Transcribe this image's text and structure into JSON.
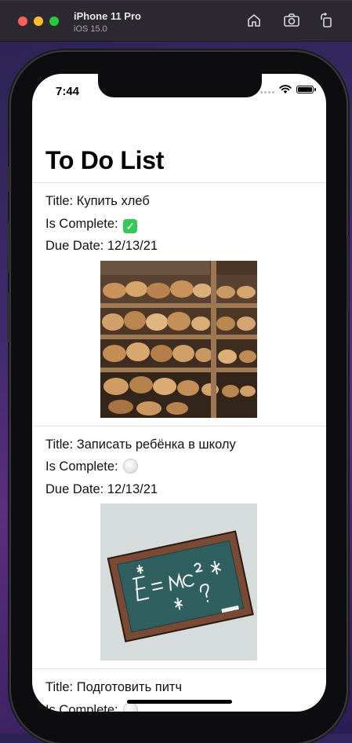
{
  "simulator": {
    "device": "iPhone 11 Pro",
    "os": "iOS 15.0",
    "icons": [
      "home-icon",
      "screenshot-icon",
      "rotate-icon"
    ]
  },
  "status_bar": {
    "time": "7:44"
  },
  "screen": {
    "title": "To Do List",
    "items": [
      {
        "title": "Title: Купить хлеб",
        "complete_label": "Is Complete:",
        "complete_state": "complete",
        "due": "Due Date: 12/13/21",
        "image": "bread-shelves-image"
      },
      {
        "title": "Title: Записать ребёнка в школу",
        "complete_label": "Is Complete:",
        "complete_state": "incomplete",
        "due": "Due Date: 12/13/21",
        "image": "chalkboard-image"
      },
      {
        "title": "Title: Подготовить питч",
        "complete_label": "Is Complete:",
        "complete_state": "incomplete"
      }
    ]
  },
  "colors": {
    "check_green": "#34c759",
    "chalkboard": "#2f5f5e",
    "frame": "#7a4a35"
  }
}
